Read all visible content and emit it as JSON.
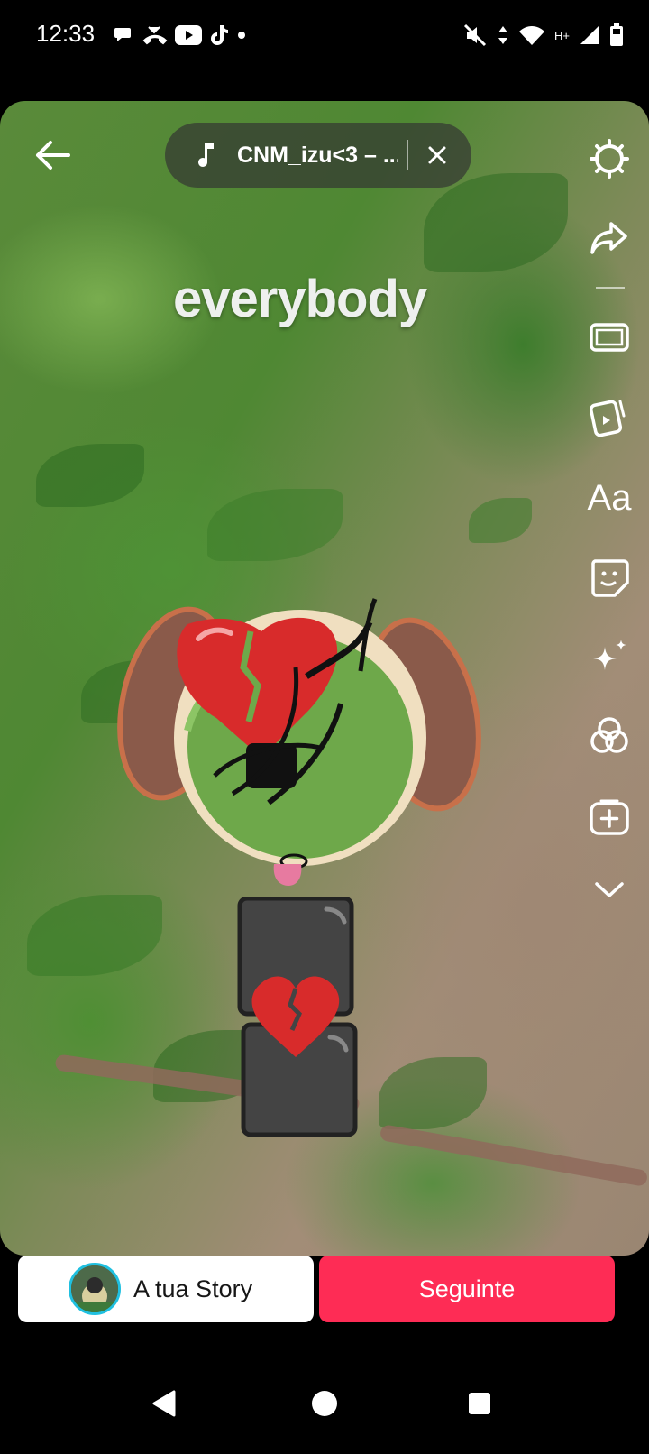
{
  "status_bar": {
    "time": "12:33",
    "network_label": "H+"
  },
  "music": {
    "title": "CNM_izu<3 – ..."
  },
  "overlay_text": "everybody",
  "toolbar": {
    "items": [
      "settings-icon",
      "share-icon",
      "crop-icon",
      "template-icon",
      "text-tool",
      "sticker-icon",
      "effects-icon",
      "filters-icon",
      "add-clip-icon",
      "more-chevron-icon"
    ],
    "text_tool_label": "Aa"
  },
  "actions": {
    "your_story_label": "A tua Story",
    "next_label": "Seguinte"
  },
  "colors": {
    "accent_next": "#fe2c55",
    "story_ring": "#20c0e0"
  }
}
